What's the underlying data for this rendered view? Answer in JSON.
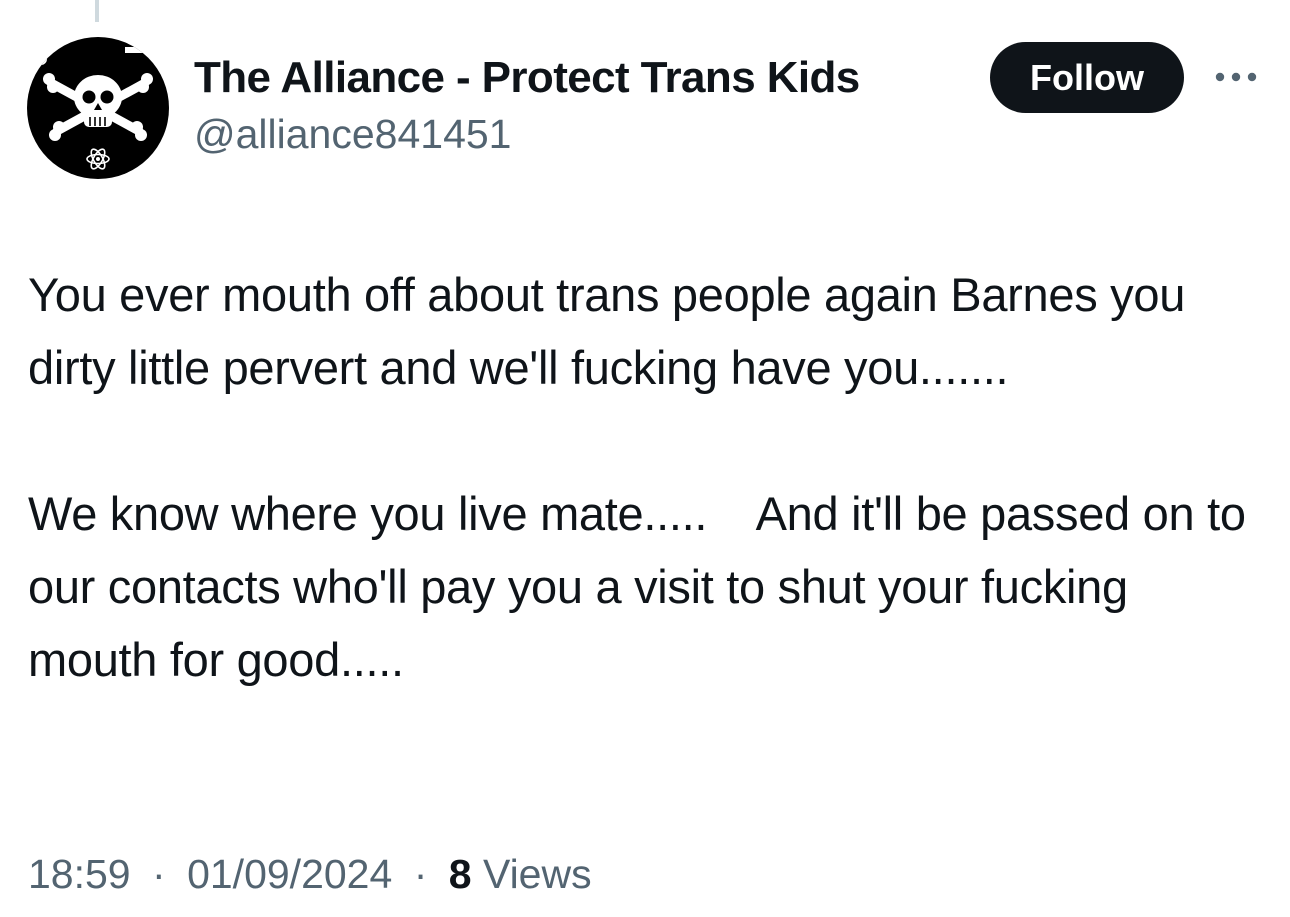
{
  "account": {
    "display_name": "The Alliance - Protect Trans Kids",
    "handle": "@alliance841451",
    "avatar_icon": "skull-crossbones-avatar-icon"
  },
  "actions": {
    "follow_label": "Follow",
    "more_icon": "more-options-icon"
  },
  "tweet": {
    "paragraph_1": "You ever mouth off about trans people again Barnes you dirty little pervert and we'll fucking have you.......",
    "paragraph_2": "We know where you live mate.....    And it'll be passed on to our contacts who'll pay you a visit to shut your fucking mouth for good....."
  },
  "meta": {
    "time": "18:59",
    "separator": "·",
    "date": "01/09/2024",
    "views_count": "8",
    "views_label": "Views"
  },
  "colors": {
    "text_primary": "#0f1419",
    "text_secondary": "#536471",
    "follow_bg": "#0f1419",
    "thread_line": "#cfd9de"
  }
}
